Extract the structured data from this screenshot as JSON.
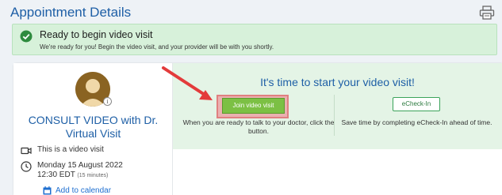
{
  "header": {
    "title": "Appointment Details",
    "print_icon": "printer-icon"
  },
  "alert": {
    "icon": "check-circle-icon",
    "title": "Ready to begin video visit",
    "message": "We're ready for you! Begin the video visit, and your provider will be with you shortly."
  },
  "appointment": {
    "visit_title": "CONSULT VIDEO with Dr. Virtual Visit",
    "video_note": "This is a video visit",
    "date": "Monday 15 August 2022",
    "time": "12:30 EDT",
    "duration": "(15 minutes)",
    "add_to_calendar": "Add to calendar"
  },
  "banner": {
    "heading": "It's time to start your video visit!",
    "join_button": "Join video visit",
    "join_desc": "When you are ready to talk to your doctor, click the button.",
    "echeckin_button": "eCheck-In",
    "echeckin_desc": "Save time by completing eCheck-In ahead of time."
  },
  "colors": {
    "accent": "#1e5fa6",
    "success_bg": "#d7f1da",
    "join_button": "#7cc044",
    "highlight": "#e08080",
    "arrow": "#e33b3b"
  }
}
